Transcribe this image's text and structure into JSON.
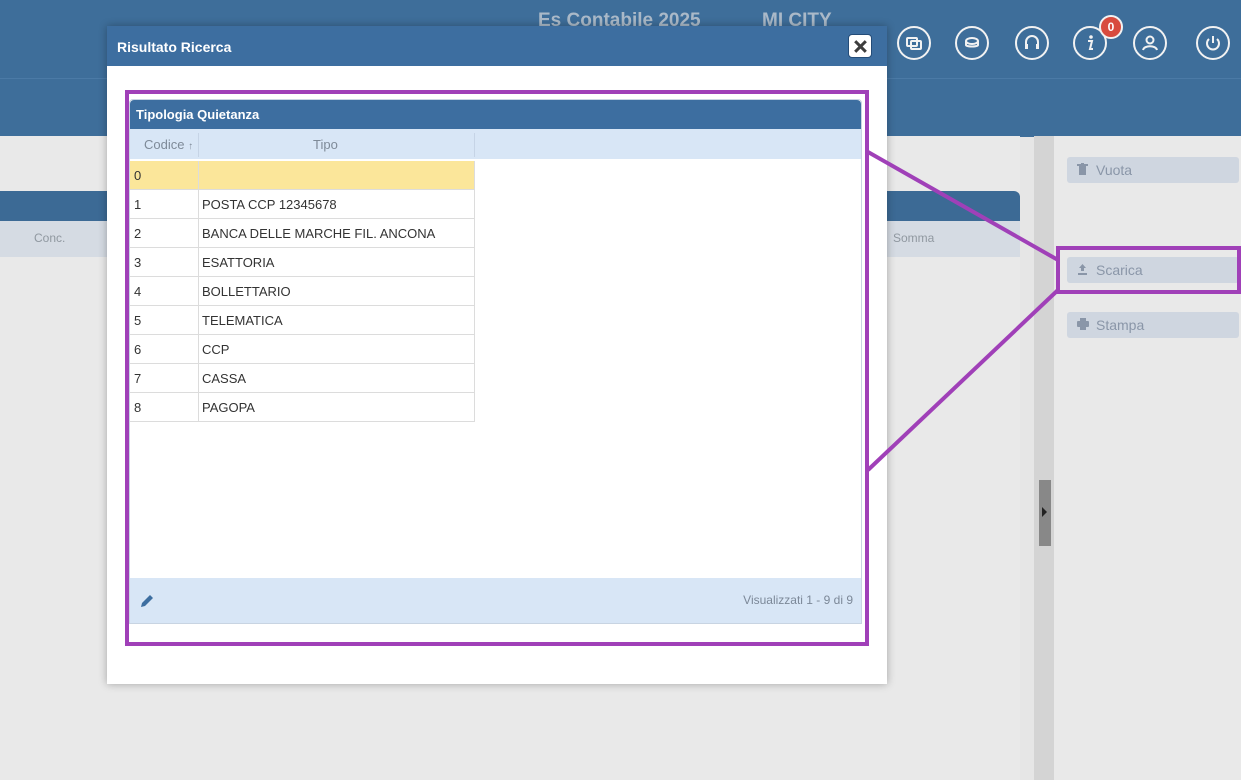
{
  "app": {
    "fiscal_year_label": "Es Contabile 2025",
    "entity_label": "MI CITY",
    "notifications_count": "0",
    "icons": [
      "window-icon",
      "coins-icon",
      "support-icon",
      "info-icon",
      "user-icon",
      "power-icon"
    ]
  },
  "main_grid": {
    "columns": [
      "Conc.",
      "Somma"
    ]
  },
  "side_buttons": [
    {
      "label": "Vuota",
      "icon": "trash-icon"
    },
    {
      "label": "Scarica",
      "icon": "download-icon"
    },
    {
      "label": "Stampa",
      "icon": "print-icon"
    }
  ],
  "modal": {
    "title": "Risultato Ricerca",
    "panel_title": "Tipologia Quietanza",
    "columns": {
      "codice": "Codice",
      "sort_marker": "↑",
      "tipo": "Tipo"
    },
    "rows": [
      {
        "codice": "0",
        "tipo": "",
        "selected": true
      },
      {
        "codice": "1",
        "tipo": "POSTA CCP 12345678"
      },
      {
        "codice": "2",
        "tipo": "BANCA DELLE MARCHE FIL. ANCONA"
      },
      {
        "codice": "3",
        "tipo": "ESATTORIA"
      },
      {
        "codice": "4",
        "tipo": "BOLLETTARIO"
      },
      {
        "codice": "5",
        "tipo": "TELEMATICA"
      },
      {
        "codice": "6",
        "tipo": "CCP"
      },
      {
        "codice": "7",
        "tipo": "CASSA"
      },
      {
        "codice": "8",
        "tipo": "PAGOPA"
      }
    ],
    "pager_text": "Visualizzati 1 - 9 di 9"
  },
  "colors": {
    "header_blue": "#3d6ea0",
    "highlight_purple": "#a040b8",
    "selected_row": "#fbe69a"
  }
}
